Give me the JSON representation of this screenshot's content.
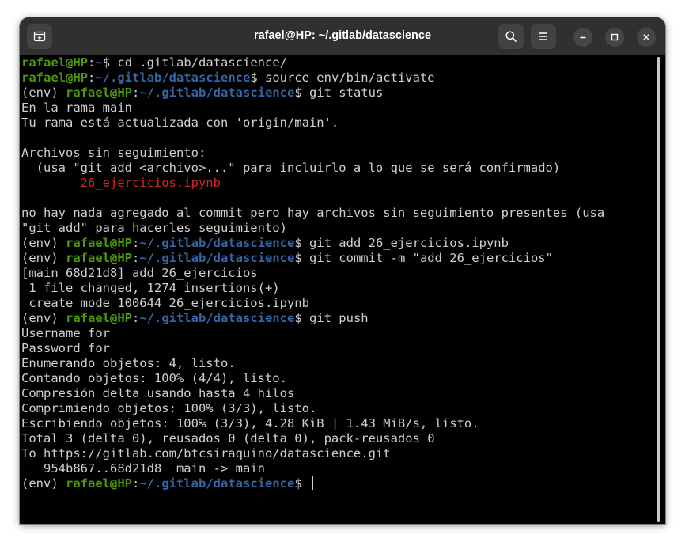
{
  "window": {
    "title": "rafael@HP: ~/.gitlab/datascience"
  },
  "icons": {
    "new_tab": "new-tab-icon",
    "search": "search-icon",
    "menu": "hamburger-menu-icon",
    "minimize": "minimize-icon",
    "maximize": "maximize-icon",
    "close": "close-icon"
  },
  "colors": {
    "user_host": "#4e9a06",
    "path": "#3465a4",
    "untracked_file": "#cc2929",
    "text": "#d0d0d0",
    "background": "#000000",
    "titlebar": "#303030"
  },
  "terminal": {
    "lines": [
      {
        "kind": "prompt",
        "env": "",
        "user": "rafael@HP",
        "path": "~",
        "cmd": "cd .gitlab/datascience/"
      },
      {
        "kind": "prompt",
        "env": "",
        "user": "rafael@HP",
        "path": "~/.gitlab/datascience",
        "cmd": "source env/bin/activate"
      },
      {
        "kind": "prompt",
        "env": "(env) ",
        "user": "rafael@HP",
        "path": "~/.gitlab/datascience",
        "cmd": "git status"
      },
      {
        "kind": "text",
        "text": "En la rama main"
      },
      {
        "kind": "text",
        "text": "Tu rama está actualizada con 'origin/main'."
      },
      {
        "kind": "text",
        "text": ""
      },
      {
        "kind": "text",
        "text": "Archivos sin seguimiento:"
      },
      {
        "kind": "text",
        "text": "  (usa \"git add <archivo>...\" para incluirlo a lo que se será confirmado)"
      },
      {
        "kind": "untracked",
        "text": "        26_ejercicios.ipynb"
      },
      {
        "kind": "text",
        "text": ""
      },
      {
        "kind": "text",
        "text": "no hay nada agregado al commit pero hay archivos sin seguimiento presentes (usa"
      },
      {
        "kind": "text",
        "text": "\"git add\" para hacerles seguimiento)"
      },
      {
        "kind": "prompt",
        "env": "(env) ",
        "user": "rafael@HP",
        "path": "~/.gitlab/datascience",
        "cmd": "git add 26_ejercicios.ipynb"
      },
      {
        "kind": "prompt",
        "env": "(env) ",
        "user": "rafael@HP",
        "path": "~/.gitlab/datascience",
        "cmd": "git commit -m \"add 26_ejercicios\""
      },
      {
        "kind": "text",
        "text": "[main 68d21d8] add 26_ejercicios"
      },
      {
        "kind": "text",
        "text": " 1 file changed, 1274 insertions(+)"
      },
      {
        "kind": "text",
        "text": " create mode 100644 26_ejercicios.ipynb"
      },
      {
        "kind": "prompt",
        "env": "(env) ",
        "user": "rafael@HP",
        "path": "~/.gitlab/datascience",
        "cmd": "git push"
      },
      {
        "kind": "text",
        "text": "Username for"
      },
      {
        "kind": "text",
        "text": "Password for"
      },
      {
        "kind": "text",
        "text": "Enumerando objetos: 4, listo."
      },
      {
        "kind": "text",
        "text": "Contando objetos: 100% (4/4), listo."
      },
      {
        "kind": "text",
        "text": "Compresión delta usando hasta 4 hilos"
      },
      {
        "kind": "text",
        "text": "Comprimiendo objetos: 100% (3/3), listo."
      },
      {
        "kind": "text",
        "text": "Escribiendo objetos: 100% (3/3), 4.28 KiB | 1.43 MiB/s, listo."
      },
      {
        "kind": "text",
        "text": "Total 3 (delta 0), reusados 0 (delta 0), pack-reusados 0"
      },
      {
        "kind": "text",
        "text": "To https://gitlab.com/btcsiraquino/datascience.git"
      },
      {
        "kind": "text",
        "text": "   954b867..68d21d8  main -> main"
      },
      {
        "kind": "prompt",
        "env": "(env) ",
        "user": "rafael@HP",
        "path": "~/.gitlab/datascience",
        "cmd": "",
        "cursor": true
      }
    ]
  }
}
